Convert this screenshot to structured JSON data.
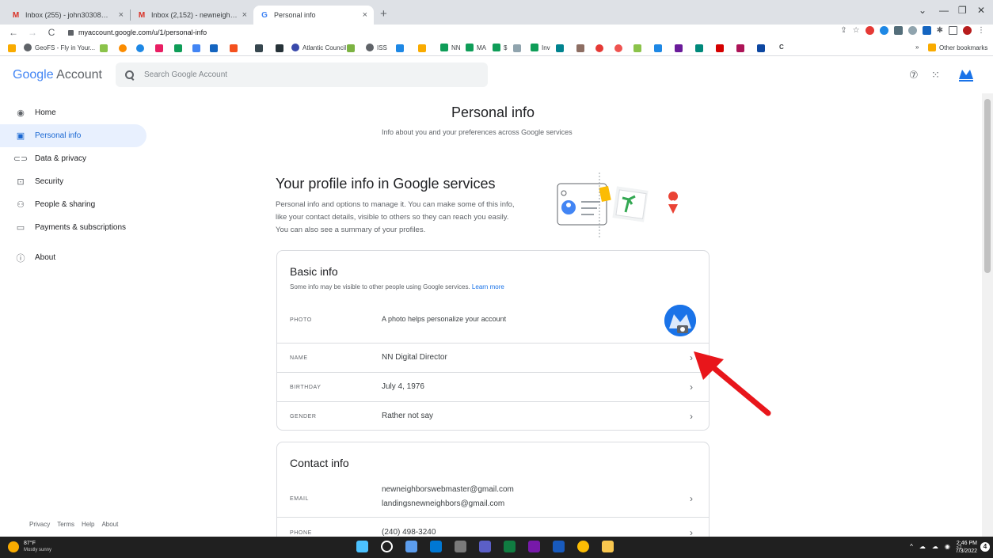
{
  "browser": {
    "tabs": [
      {
        "title": "Inbox (255) - john30308@gmail.c",
        "icon": "gmail-icon"
      },
      {
        "title": "Inbox (2,152) - newneighborswel",
        "icon": "gmail-icon"
      },
      {
        "title": "Personal info",
        "icon": "google-icon"
      }
    ],
    "url": "myaccount.google.com/u/1/personal-info",
    "bookmarks": [
      {
        "label": "GeoFS - Fly in Your..."
      },
      {
        "label": "Atlantic Council"
      },
      {
        "label": "ISS"
      },
      {
        "label": "NN"
      },
      {
        "label": "MA"
      },
      {
        "label": "$"
      },
      {
        "label": "Inv"
      },
      {
        "label": "C"
      },
      {
        "label": "Other bookmarks"
      }
    ],
    "overflow": "»"
  },
  "header": {
    "logo_google": "Google",
    "logo_account": "Account",
    "search_placeholder": "Search Google Account"
  },
  "sidebar": {
    "items": [
      {
        "label": "Home",
        "icon": "home-icon"
      },
      {
        "label": "Personal info",
        "icon": "id-card-icon"
      },
      {
        "label": "Data & privacy",
        "icon": "toggle-icon"
      },
      {
        "label": "Security",
        "icon": "lock-icon"
      },
      {
        "label": "People & sharing",
        "icon": "people-icon"
      },
      {
        "label": "Payments & subscriptions",
        "icon": "credit-card-icon"
      },
      {
        "label": "About",
        "icon": "info-icon"
      }
    ],
    "footer": [
      "Privacy",
      "Terms",
      "Help",
      "About"
    ]
  },
  "main": {
    "title": "Personal info",
    "subtitle": "Info about you and your preferences across Google services",
    "profile_title": "Your profile info in Google services",
    "profile_desc": "Personal info and options to manage it. You can make some of this info, like your contact details, visible to others so they can reach you easily. You can also see a summary of your profiles.",
    "basic_info": {
      "title": "Basic info",
      "subtitle": "Some info may be visible to other people using Google services.",
      "learn_more": "Learn more",
      "photo_label": "PHOTO",
      "photo_desc": "A photo helps personalize your account",
      "name_label": "NAME",
      "name_value": "NN Digital Director",
      "birthday_label": "BIRTHDAY",
      "birthday_value": "July 4, 1976",
      "gender_label": "GENDER",
      "gender_value": "Rather not say"
    },
    "contact_info": {
      "title": "Contact info",
      "email_label": "EMAIL",
      "email_1": "newneighborswebmaster@gmail.com",
      "email_2": "landingsnewneighbors@gmail.com",
      "phone_label": "PHONE",
      "phone_value": "(240) 498-3240"
    }
  },
  "taskbar": {
    "weather_temp": "87°F",
    "weather_desc": "Mostly sunny",
    "time": "2:46 PM",
    "date": "7/3/2022",
    "notification_count": "4"
  },
  "colors": {
    "accent": "#1a73e8",
    "annotation_arrow": "#e8161b"
  }
}
